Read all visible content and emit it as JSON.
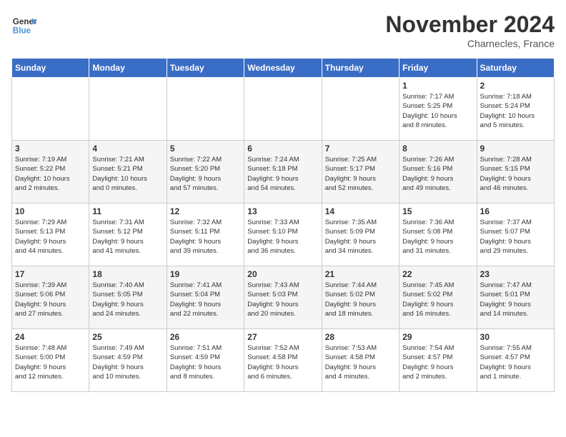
{
  "header": {
    "logo_line1": "General",
    "logo_line2": "Blue",
    "month_title": "November 2024",
    "location": "Charnecles, France"
  },
  "weekdays": [
    "Sunday",
    "Monday",
    "Tuesday",
    "Wednesday",
    "Thursday",
    "Friday",
    "Saturday"
  ],
  "weeks": [
    [
      {
        "day": "",
        "info": ""
      },
      {
        "day": "",
        "info": ""
      },
      {
        "day": "",
        "info": ""
      },
      {
        "day": "",
        "info": ""
      },
      {
        "day": "",
        "info": ""
      },
      {
        "day": "1",
        "info": "Sunrise: 7:17 AM\nSunset: 5:25 PM\nDaylight: 10 hours\nand 8 minutes."
      },
      {
        "day": "2",
        "info": "Sunrise: 7:18 AM\nSunset: 5:24 PM\nDaylight: 10 hours\nand 5 minutes."
      }
    ],
    [
      {
        "day": "3",
        "info": "Sunrise: 7:19 AM\nSunset: 5:22 PM\nDaylight: 10 hours\nand 2 minutes."
      },
      {
        "day": "4",
        "info": "Sunrise: 7:21 AM\nSunset: 5:21 PM\nDaylight: 10 hours\nand 0 minutes."
      },
      {
        "day": "5",
        "info": "Sunrise: 7:22 AM\nSunset: 5:20 PM\nDaylight: 9 hours\nand 57 minutes."
      },
      {
        "day": "6",
        "info": "Sunrise: 7:24 AM\nSunset: 5:18 PM\nDaylight: 9 hours\nand 54 minutes."
      },
      {
        "day": "7",
        "info": "Sunrise: 7:25 AM\nSunset: 5:17 PM\nDaylight: 9 hours\nand 52 minutes."
      },
      {
        "day": "8",
        "info": "Sunrise: 7:26 AM\nSunset: 5:16 PM\nDaylight: 9 hours\nand 49 minutes."
      },
      {
        "day": "9",
        "info": "Sunrise: 7:28 AM\nSunset: 5:15 PM\nDaylight: 9 hours\nand 46 minutes."
      }
    ],
    [
      {
        "day": "10",
        "info": "Sunrise: 7:29 AM\nSunset: 5:13 PM\nDaylight: 9 hours\nand 44 minutes."
      },
      {
        "day": "11",
        "info": "Sunrise: 7:31 AM\nSunset: 5:12 PM\nDaylight: 9 hours\nand 41 minutes."
      },
      {
        "day": "12",
        "info": "Sunrise: 7:32 AM\nSunset: 5:11 PM\nDaylight: 9 hours\nand 39 minutes."
      },
      {
        "day": "13",
        "info": "Sunrise: 7:33 AM\nSunset: 5:10 PM\nDaylight: 9 hours\nand 36 minutes."
      },
      {
        "day": "14",
        "info": "Sunrise: 7:35 AM\nSunset: 5:09 PM\nDaylight: 9 hours\nand 34 minutes."
      },
      {
        "day": "15",
        "info": "Sunrise: 7:36 AM\nSunset: 5:08 PM\nDaylight: 9 hours\nand 31 minutes."
      },
      {
        "day": "16",
        "info": "Sunrise: 7:37 AM\nSunset: 5:07 PM\nDaylight: 9 hours\nand 29 minutes."
      }
    ],
    [
      {
        "day": "17",
        "info": "Sunrise: 7:39 AM\nSunset: 5:06 PM\nDaylight: 9 hours\nand 27 minutes."
      },
      {
        "day": "18",
        "info": "Sunrise: 7:40 AM\nSunset: 5:05 PM\nDaylight: 9 hours\nand 24 minutes."
      },
      {
        "day": "19",
        "info": "Sunrise: 7:41 AM\nSunset: 5:04 PM\nDaylight: 9 hours\nand 22 minutes."
      },
      {
        "day": "20",
        "info": "Sunrise: 7:43 AM\nSunset: 5:03 PM\nDaylight: 9 hours\nand 20 minutes."
      },
      {
        "day": "21",
        "info": "Sunrise: 7:44 AM\nSunset: 5:02 PM\nDaylight: 9 hours\nand 18 minutes."
      },
      {
        "day": "22",
        "info": "Sunrise: 7:45 AM\nSunset: 5:02 PM\nDaylight: 9 hours\nand 16 minutes."
      },
      {
        "day": "23",
        "info": "Sunrise: 7:47 AM\nSunset: 5:01 PM\nDaylight: 9 hours\nand 14 minutes."
      }
    ],
    [
      {
        "day": "24",
        "info": "Sunrise: 7:48 AM\nSunset: 5:00 PM\nDaylight: 9 hours\nand 12 minutes."
      },
      {
        "day": "25",
        "info": "Sunrise: 7:49 AM\nSunset: 4:59 PM\nDaylight: 9 hours\nand 10 minutes."
      },
      {
        "day": "26",
        "info": "Sunrise: 7:51 AM\nSunset: 4:59 PM\nDaylight: 9 hours\nand 8 minutes."
      },
      {
        "day": "27",
        "info": "Sunrise: 7:52 AM\nSunset: 4:58 PM\nDaylight: 9 hours\nand 6 minutes."
      },
      {
        "day": "28",
        "info": "Sunrise: 7:53 AM\nSunset: 4:58 PM\nDaylight: 9 hours\nand 4 minutes."
      },
      {
        "day": "29",
        "info": "Sunrise: 7:54 AM\nSunset: 4:57 PM\nDaylight: 9 hours\nand 2 minutes."
      },
      {
        "day": "30",
        "info": "Sunrise: 7:55 AM\nSunset: 4:57 PM\nDaylight: 9 hours\nand 1 minute."
      }
    ]
  ]
}
